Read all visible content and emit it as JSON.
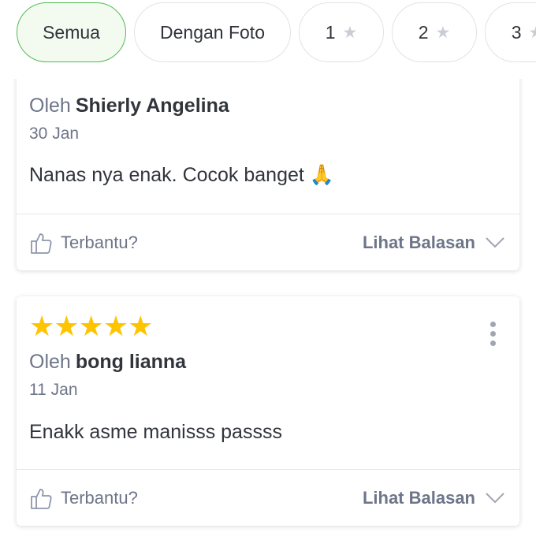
{
  "filters": [
    {
      "label": "Semua",
      "active": true
    },
    {
      "label": "Dengan Foto",
      "active": false
    },
    {
      "label": "1",
      "star_icon": "star-icon",
      "active": false
    },
    {
      "label": "2",
      "star_icon": "star-icon",
      "active": false
    },
    {
      "label": "3",
      "star_icon": "star-icon",
      "active": false
    }
  ],
  "reviews": [
    {
      "by_prefix": "Oleh",
      "reviewer": "Shierly Angelina",
      "date": "30 Jan",
      "text": "Nanas nya enak. Cocok banget 🙏",
      "helpful_label": "Terbantu?",
      "replies_label": "Lihat Balasan"
    },
    {
      "rating": 5,
      "stars": "★★★★★",
      "by_prefix": "Oleh",
      "reviewer": "bong lianna",
      "date": "11 Jan",
      "text": "Enakk asme manisss passss",
      "helpful_label": "Terbantu?",
      "replies_label": "Lihat Balasan"
    }
  ],
  "colors": {
    "accent_green": "#4fbb53",
    "star_gold": "#ffc400",
    "text_primary": "#31353b",
    "text_secondary": "#6d7588"
  }
}
